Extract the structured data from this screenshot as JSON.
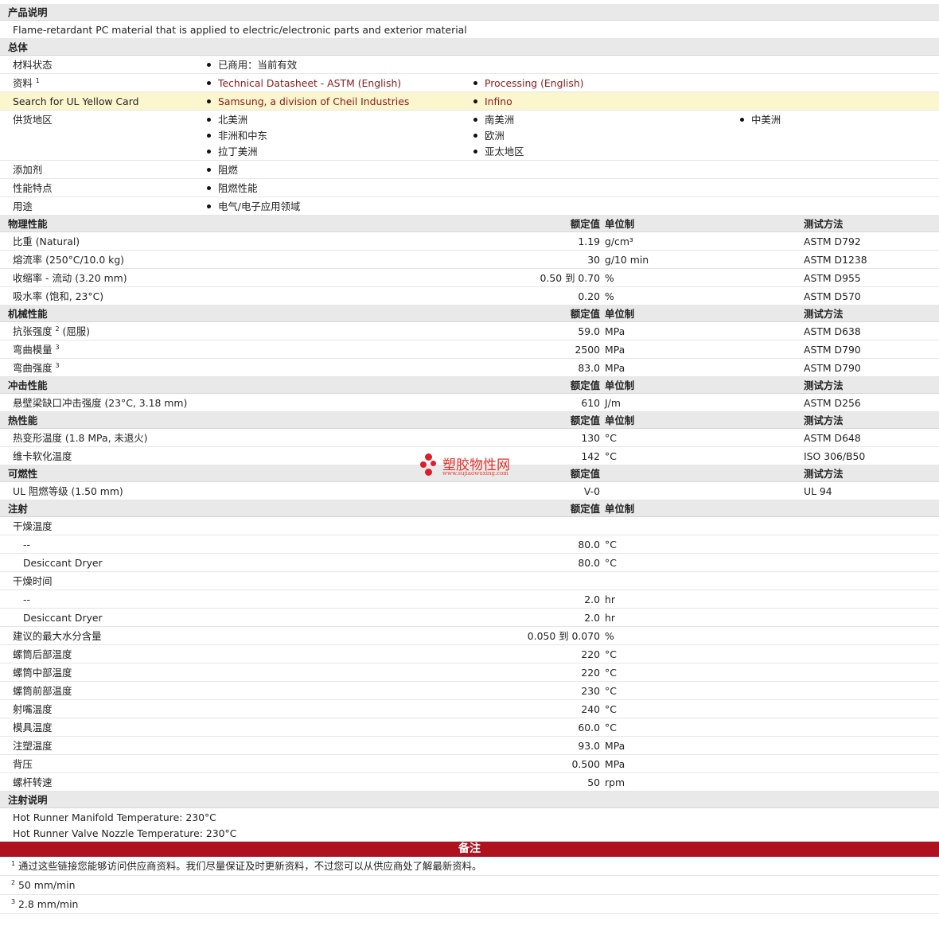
{
  "product": {
    "section_title": "产品说明",
    "description": "Flame-retardant PC material that is applied to electric/electronic parts and exterior material"
  },
  "general": {
    "section_title": "总体",
    "material_status_label": "材料状态",
    "material_status_value": "已商用：当前有效",
    "docs_label": "资料",
    "docs_sup": "1",
    "docs_link1": "Technical Datasheet - ASTM (English)",
    "docs_link2": "Processing (English)",
    "ul_label": "Search for UL Yellow Card",
    "ul_link1": "Samsung, a division of Cheil Industries",
    "ul_link2": "Infino",
    "region_label": "供货地区",
    "regions": [
      "北美洲",
      "南美洲",
      "中美洲",
      "非洲和中东",
      "欧洲",
      "拉丁美洲",
      "亚太地区"
    ],
    "additive_label": "添加剂",
    "additive_value": "阻燃",
    "feature_label": "性能特点",
    "feature_value": "阻燃性能",
    "use_label": "用途",
    "use_value": "电气/电子应用领域"
  },
  "col_headers": {
    "nominal": "额定值",
    "unit": "单位制",
    "method": "测试方法"
  },
  "physical": {
    "title": "物理性能",
    "rows": [
      {
        "label": "比重  (Natural)",
        "value": "1.19",
        "unit": "g/cm³",
        "method": "ASTM D792"
      },
      {
        "label": "熔流率  (250°C/10.0 kg)",
        "value": "30",
        "unit": "g/10 min",
        "method": "ASTM D1238"
      },
      {
        "label": "收缩率  - 流动  (3.20 mm)",
        "value": "0.50 到  0.70",
        "unit": "%",
        "method": "ASTM D955"
      },
      {
        "label": "吸水率  (饱和, 23°C)",
        "value": "0.20",
        "unit": "%",
        "method": "ASTM D570"
      }
    ]
  },
  "mechanical": {
    "title": "机械性能",
    "rows": [
      {
        "label": "抗张强度",
        "sup": "2",
        "suffix": " (屈服)",
        "value": "59.0",
        "unit": "MPa",
        "method": "ASTM D638"
      },
      {
        "label": "弯曲模量",
        "sup": "3",
        "suffix": "",
        "value": "2500",
        "unit": "MPa",
        "method": "ASTM D790"
      },
      {
        "label": "弯曲强度",
        "sup": "3",
        "suffix": "",
        "value": "83.0",
        "unit": "MPa",
        "method": "ASTM D790"
      }
    ]
  },
  "impact": {
    "title": "冲击性能",
    "rows": [
      {
        "label": "悬壁梁缺口冲击强度  (23°C, 3.18 mm)",
        "value": "610",
        "unit": "J/m",
        "method": "ASTM D256"
      }
    ]
  },
  "thermal": {
    "title": "热性能",
    "rows": [
      {
        "label": "热变形温度  (1.8 MPa, 未退火)",
        "value": "130",
        "unit": "°C",
        "method": "ASTM D648"
      },
      {
        "label": "维卡软化温度",
        "value": "142",
        "unit": "°C",
        "method": "ISO 306/B50"
      }
    ]
  },
  "flammability": {
    "title": "可燃性",
    "rows": [
      {
        "label": "UL 阻燃等级  (1.50 mm)",
        "value": "V-0",
        "unit": "",
        "method": "UL 94"
      }
    ]
  },
  "injection": {
    "title": "注射",
    "drying_temp_label": "干燥温度",
    "drying_temp_rows": [
      {
        "label": "--",
        "value": "80.0",
        "unit": "°C"
      },
      {
        "label": "Desiccant Dryer",
        "value": "80.0",
        "unit": "°C"
      }
    ],
    "drying_time_label": "干燥时间",
    "drying_time_rows": [
      {
        "label": "--",
        "value": "2.0",
        "unit": "hr"
      },
      {
        "label": "Desiccant Dryer",
        "value": "2.0",
        "unit": "hr"
      }
    ],
    "rows": [
      {
        "label": "建议的最大水分含量",
        "value": "0.050 到  0.070",
        "unit": "%"
      },
      {
        "label": "螺筒后部温度",
        "value": "220",
        "unit": "°C"
      },
      {
        "label": "螺筒中部温度",
        "value": "220",
        "unit": "°C"
      },
      {
        "label": "螺筒前部温度",
        "value": "230",
        "unit": "°C"
      },
      {
        "label": "射嘴温度",
        "value": "240",
        "unit": "°C"
      },
      {
        "label": "模具温度",
        "value": "60.0",
        "unit": "°C"
      },
      {
        "label": "注塑温度",
        "value": "93.0",
        "unit": "MPa"
      },
      {
        "label": "背压",
        "value": "0.500",
        "unit": "MPa"
      },
      {
        "label": "螺杆转速",
        "value": "50",
        "unit": "rpm"
      }
    ]
  },
  "injection_notes": {
    "title": "注射说明",
    "line1": "Hot Runner Manifold Temperature: 230°C",
    "line2": "Hot Runner Valve Nozzle Temperature: 230°C"
  },
  "notes": {
    "title": "备注",
    "items": [
      {
        "sup": "1",
        "text": "通过这些链接您能够访问供应商资料。我们尽量保证及时更新资料，不过您可以从供应商处了解最新资料。"
      },
      {
        "sup": "2",
        "text": "50 mm/min"
      },
      {
        "sup": "3",
        "text": "2.8 mm/min"
      }
    ]
  },
  "watermark": {
    "title": "塑胶物性网",
    "url": "www.sujiaowuxing.com"
  }
}
